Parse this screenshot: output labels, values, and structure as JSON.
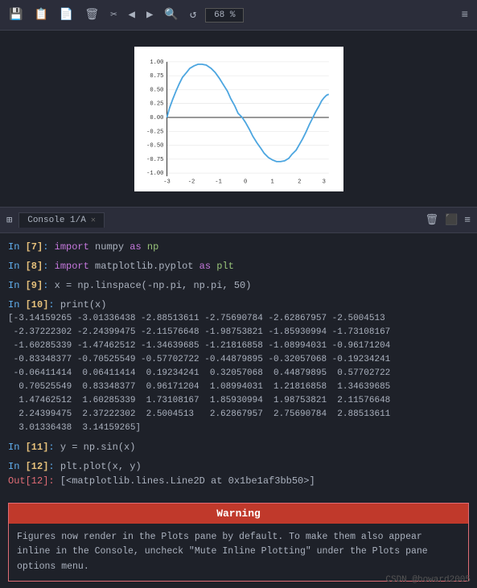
{
  "toolbar": {
    "zoom": "68 %",
    "icons": [
      "save",
      "copy",
      "clipboard",
      "trash",
      "cut",
      "arrow-left",
      "arrow-right",
      "search",
      "refresh",
      "menu"
    ]
  },
  "plot": {
    "x_labels": [
      "-3",
      "-2",
      "-1",
      "0",
      "1",
      "2",
      "3"
    ],
    "y_labels": [
      "1.00",
      "0.75",
      "0.50",
      "0.25",
      "0.00",
      "-0.25",
      "-0.50",
      "-0.75",
      "-1.00"
    ]
  },
  "console": {
    "tab_label": "Console 1/A",
    "lines": [
      {
        "prompt": "In [7]:",
        "code": " import numpy as np"
      },
      {
        "prompt": "In [8]:",
        "code": " import matplotlib.pyplot as plt"
      },
      {
        "prompt": "In [9]:",
        "code": " x = np.linspace(-np.pi, np.pi, 50)"
      },
      {
        "prompt": "In [10]:",
        "code": " print(x)"
      },
      {
        "output": "[-3.14159265 -3.01336438 -2.88513611 -2.75690784 -2.62867957 -2.5004513\n  -2.37222302 -2.24399475 -2.11576648 -1.98753821 -1.85930994 -1.73108167\n  -1.60285339 -1.47462512 -1.34639685 -1.21816858 -1.08994031 -0.96171204\n  -0.83348377 -0.70525549 -0.57702722 -0.44879895 -0.32057068 -0.19234241\n  -0.06411414  0.06411414  0.19234241  0.32057068  0.44879895  0.57702722\n   0.70525549  0.83348377  0.96171204  1.08994031  1.21816858  1.34639685\n   1.47462512  1.60285339  1.73108167  1.85930994  1.98753821  2.11576648\n   2.24399475  2.37222302  2.5004513   2.62867957  2.75690784  2.88513611\n   3.01336438  3.14159265]"
      },
      {
        "prompt": "In [11]:",
        "code": " y = np.sin(x)"
      },
      {
        "prompt": "In [12]:",
        "code": " plt.plot(x, y)"
      },
      {
        "out_prompt": "Out[12]:",
        "out_code": " [<matplotlib.lines.Line2D at 0x1be1af3bb50>]"
      }
    ],
    "warning": {
      "header": "Warning",
      "body": "Figures now render in the Plots pane by default. To make them also appear inline in the Console, uncheck \"Mute Inline Plotting\" under the Plots pane options menu."
    }
  },
  "watermark": "CSDN @howard2005"
}
